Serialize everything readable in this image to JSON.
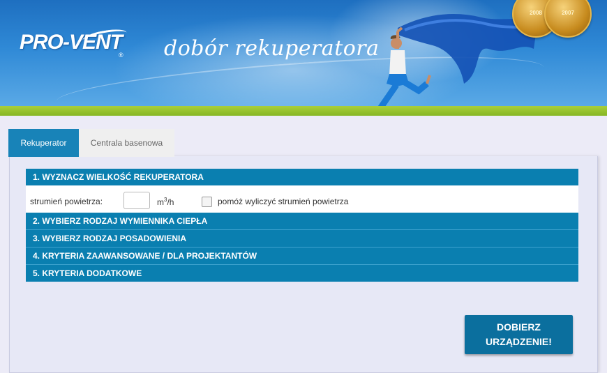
{
  "header": {
    "logo_text": "PRO-VENT",
    "logo_reg": "®",
    "tagline": "dobór rekuperatora",
    "medals": [
      "2008",
      "2007"
    ],
    "colors": {
      "sky": "#2f89d6",
      "green": "#8cbc28"
    }
  },
  "tabs": [
    {
      "label": "Rekuperator",
      "active": true
    },
    {
      "label": "Centrala basenowa",
      "active": false
    }
  ],
  "sections": [
    "1. WYZNACZ WIELKOŚĆ REKUPERATORA",
    "2. WYBIERZ RODZAJ WYMIENNIKA CIEPŁA",
    "3. WYBIERZ RODZAJ POSADOWIENIA",
    "4. KRYTERIA ZAAWANSOWANE / DLA PROJEKTANTÓW",
    "5. KRYTERIA DODATKOWE"
  ],
  "flow": {
    "label": "strumień powietrza:",
    "value": "",
    "unit_base": "m",
    "unit_sup": "3",
    "unit_rest": "/h",
    "help_checkbox_label": "pomóż wyliczyć strumień powietrza",
    "help_checked": false
  },
  "submit": {
    "line1": "DOBIERZ",
    "line2": "URZĄDZENIE!"
  },
  "accent_color": "#0a7fb0"
}
